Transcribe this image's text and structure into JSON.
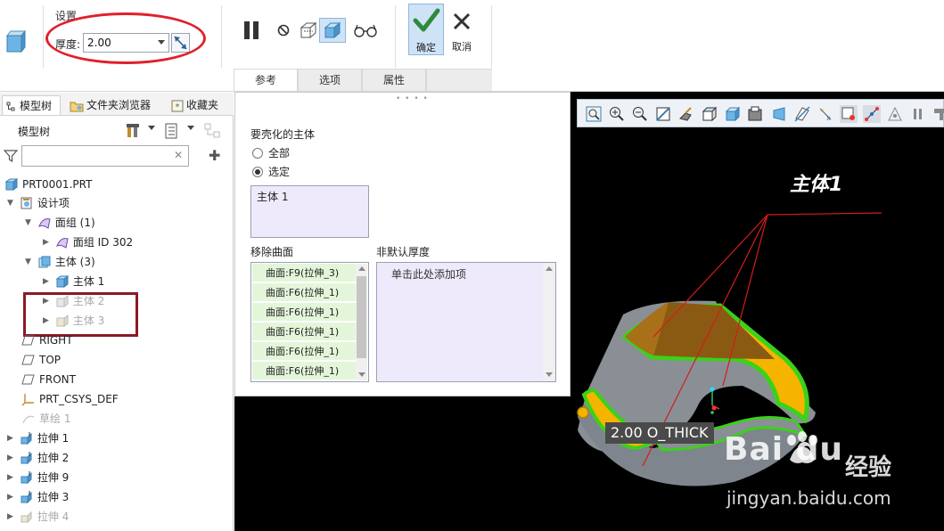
{
  "ribbon": {
    "settings_title": "设置",
    "thickness_label": "厚度:",
    "thickness_value": "2.00",
    "ok_label": "确定",
    "cancel_label": "取消",
    "tabs": [
      {
        "label": "参考"
      },
      {
        "label": "选项"
      },
      {
        "label": "属性"
      }
    ]
  },
  "left_panel": {
    "tabs": [
      {
        "label": "模型树"
      },
      {
        "label": "文件夹浏览器"
      },
      {
        "label": "收藏夹"
      }
    ],
    "tree_header": "模型树",
    "search_placeholder": "",
    "items": [
      {
        "label": "PRT0001.PRT"
      },
      {
        "label": "设计项"
      },
      {
        "label": "面组 (1)"
      },
      {
        "label": "面组 ID 302"
      },
      {
        "label": "主体 (3)"
      },
      {
        "label": "主体 1"
      },
      {
        "label": "主体 2"
      },
      {
        "label": "主体 3"
      },
      {
        "label": "RIGHT"
      },
      {
        "label": "TOP"
      },
      {
        "label": "FRONT"
      },
      {
        "label": "PRT_CSYS_DEF"
      },
      {
        "label": "草绘 1"
      },
      {
        "label": "拉伸 1"
      },
      {
        "label": "拉伸 2"
      },
      {
        "label": "拉伸 9"
      },
      {
        "label": "拉伸 3"
      },
      {
        "label": "拉伸 4"
      }
    ]
  },
  "dialog": {
    "bodies_title": "要壳化的主体",
    "radio_all": "全部",
    "radio_selected": "选定",
    "selected_body": "主体 1",
    "remove_title": "移除曲面",
    "nondefault_title": "非默认厚度",
    "surfaces": [
      {
        "label": "曲面:F9(拉伸_3)"
      },
      {
        "label": "曲面:F6(拉伸_1)"
      },
      {
        "label": "曲面:F6(拉伸_1)"
      },
      {
        "label": "曲面:F6(拉伸_1)"
      },
      {
        "label": "曲面:F6(拉伸_1)"
      },
      {
        "label": "曲面:F6(拉伸_1)"
      }
    ],
    "nondefault_add": "单击此处添加项"
  },
  "graphics": {
    "body_annotation": "主体1",
    "thickness_label": "2.00 O_THICK",
    "watermark_logo": "Bai du",
    "watermark_text": "经验",
    "watermark_url": "jingyan.baidu.com"
  },
  "colors": {
    "accent_red": "#e0202a",
    "highlight_box": "#8b1a26",
    "model_fill": "#f5b400",
    "model_edge": "#3ad21a",
    "model_side": "#8a8f96"
  }
}
